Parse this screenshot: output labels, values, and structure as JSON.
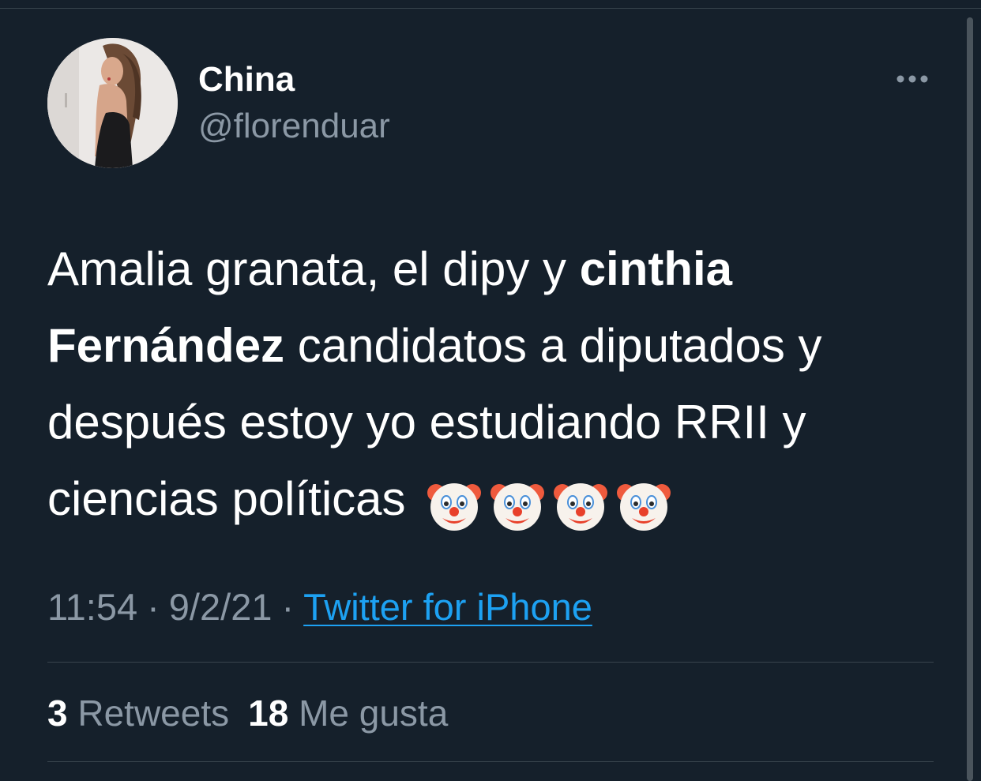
{
  "tweet": {
    "author": {
      "display_name": "China",
      "handle": "@florenduar"
    },
    "text": {
      "part1": "Amalia granata, el dipy y ",
      "bold1": "cinthia Fernández",
      "part2": " candidatos a diputados y después estoy yo estudiando RRII y ciencias políticas "
    },
    "emojis": [
      "🤡",
      "🤡",
      "🤡",
      "🤡"
    ],
    "time": "11:54",
    "date": "9/2/21",
    "separator": "·",
    "source": "Twitter for iPhone",
    "stats": {
      "retweets_count": "3",
      "retweets_label": "Retweets",
      "likes_count": "18",
      "likes_label": "Me gusta"
    }
  },
  "colors": {
    "background": "#15202b",
    "primary_text": "#ffffff",
    "secondary_text": "#8b98a5",
    "link": "#1da1f2",
    "divider": "#38444d"
  },
  "icons": {
    "more": "more-horizontal-icon",
    "emoji": "clown-face-emoji"
  }
}
